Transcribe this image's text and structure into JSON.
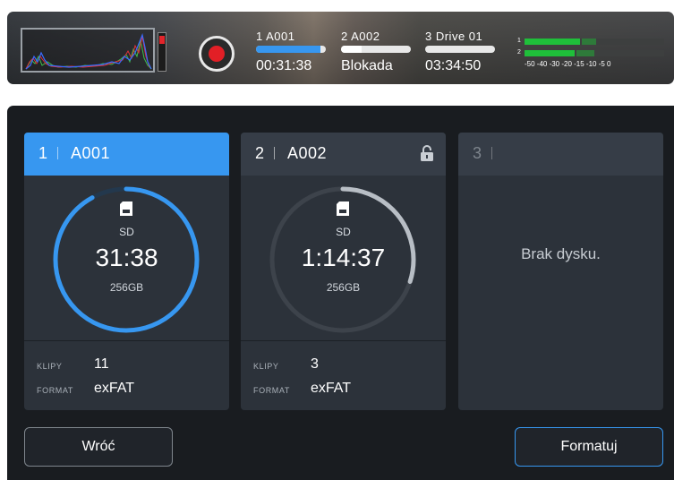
{
  "status_bar": {
    "slots": [
      {
        "label": "1  A001",
        "value": "00:31:38",
        "fill_fraction": 0.92,
        "fill_color": "#3797f0"
      },
      {
        "label": "2  A002",
        "value": "Blokada",
        "fill_fraction": 0.3,
        "fill_color": "#ffffff"
      },
      {
        "label": "3  Drive 01",
        "value": "03:34:50",
        "fill_fraction": 0.0,
        "fill_color": "#ffffff"
      }
    ],
    "audio": {
      "channel_1": "1",
      "channel_2": "2",
      "scale": "-50 -40   -30      -20  -15  -10   -5    0"
    },
    "record_icon": "record-icon"
  },
  "cards": [
    {
      "num": "1",
      "name": "A001",
      "active": true,
      "media_type": "SD",
      "time": "31:38",
      "capacity": "256GB",
      "clips_label": "KLIPY",
      "clips": "11",
      "format_label": "FORMAT",
      "format": "exFAT",
      "ring_fraction": 0.92,
      "ring_color": "#3797f0",
      "locked": false
    },
    {
      "num": "2",
      "name": "A002",
      "active": false,
      "media_type": "SD",
      "time": "1:14:37",
      "capacity": "256GB",
      "clips_label": "KLIPY",
      "clips": "3",
      "format_label": "FORMAT",
      "format": "exFAT",
      "ring_fraction": 0.3,
      "ring_color": "#b8bec5",
      "locked": true
    },
    {
      "num": "3",
      "name": "",
      "active": false,
      "empty_text": "Brak dysku."
    }
  ],
  "buttons": {
    "back": "Wróć",
    "format": "Formatuj"
  },
  "colors": {
    "accent": "#3797f0",
    "record": "#e21f26",
    "panel_bg": "#191c20",
    "card_bg": "#2c323a"
  }
}
